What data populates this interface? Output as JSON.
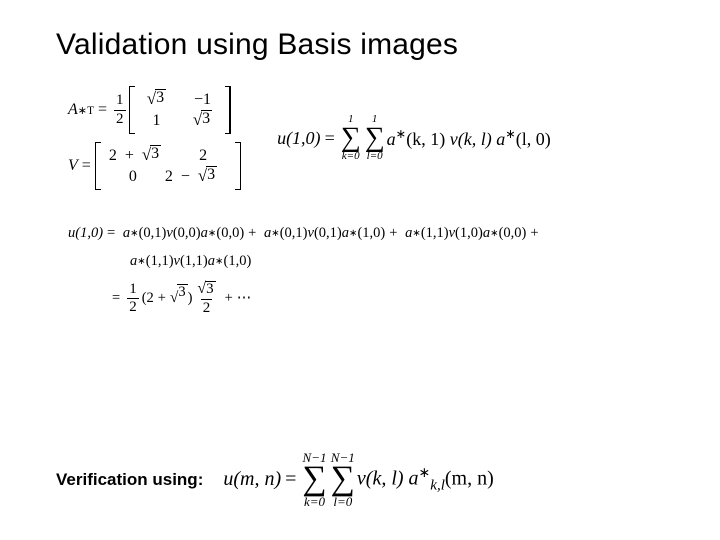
{
  "title": "Validation using Basis images",
  "matrix_A": {
    "lhs": "A",
    "lhs_sup": "∗T",
    "eq": "=",
    "factor_num": "1",
    "factor_den": "2",
    "rows": [
      [
        "√3",
        "−1"
      ],
      [
        "1",
        "√3"
      ]
    ]
  },
  "matrix_V": {
    "lhs": "V",
    "eq": "=",
    "rows": [
      [
        "2 + √3",
        "2"
      ],
      [
        "0",
        "2 − √3"
      ]
    ]
  },
  "u10_sum": {
    "lhs": "u(1,0)",
    "eq": "=",
    "sum1_top": "1",
    "sum1_bot": "k=0",
    "sum2_top": "1",
    "sum2_bot": "l=0",
    "body_a": "a",
    "body_a_sup": "∗",
    "body_a_args": "(k, 1)",
    "body_v": "v(k, l)",
    "body_a2": "a",
    "body_a2_sup": "∗",
    "body_a2_args": "(l, 0)"
  },
  "expansion": {
    "lhs": "u(1,0)",
    "eq": "=",
    "terms": [
      "a∗(0,1)v(0,0)a∗(0,0)",
      "a∗(0,1)v(0,1)a∗(1,0)",
      "a∗(1,1)v(1,0)a∗(0,0)",
      "a∗(1,1)v(1,1)a∗(1,0)"
    ],
    "plus": "+",
    "result_lead_eq": "=",
    "result_frac_num": "1",
    "result_frac_den": "2",
    "result_paren": "(2 + √3)",
    "result_frac2_num": "√3",
    "result_frac2_den": "2",
    "result_tail": "+ ⋯"
  },
  "verification": {
    "label": "Verification using:",
    "lhs": "u(m, n)",
    "eq": "=",
    "sum1_top": "N−1",
    "sum1_bot": "k=0",
    "sum2_top": "N−1",
    "sum2_bot": "l=0",
    "body_v": "v(k, l)",
    "body_a": "a",
    "body_a_sup": "∗",
    "body_a_sub": "k,l",
    "body_a_args": "(m, n)"
  }
}
